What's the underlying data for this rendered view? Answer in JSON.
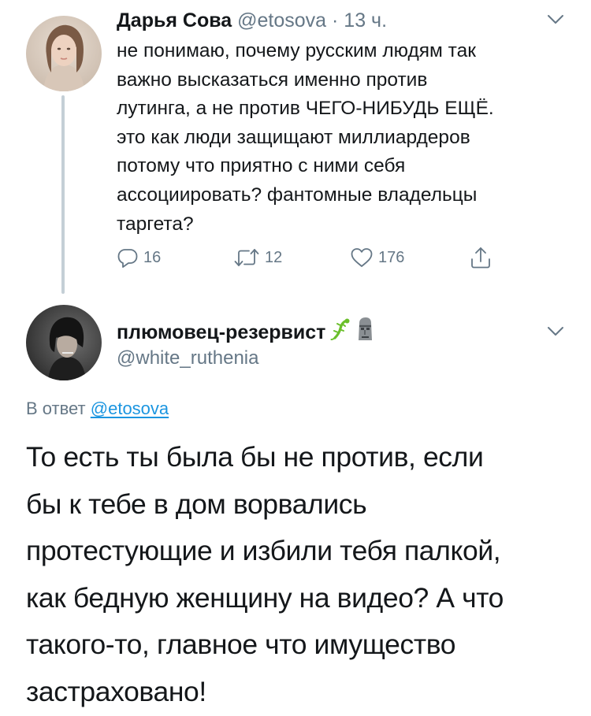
{
  "tweet1": {
    "author_name": "Дарья Сова",
    "handle": "@etosova",
    "separator": "·",
    "time": "13 ч.",
    "text_lines": [
      "не понимаю, почему русским людям так",
      "важно высказаться именно против",
      "лутинга, а не против ЧЕГО-НИБУДЬ ЕЩЁ.",
      "это как люди защищают миллиардеров",
      "потому что приятно с ними себя",
      "ассоциировать? фантомные владельцы",
      "таргета?"
    ],
    "reply_count": "16",
    "retweet_count": "12",
    "like_count": "176"
  },
  "tweet2": {
    "author_name": "плюмовец-резервист",
    "handle": "@white_ruthenia",
    "reply_prefix": "В ответ",
    "reply_mention": "@etosova",
    "text_lines": [
      "То есть ты была бы не против, если",
      "бы к тебе в дом ворвались",
      "протестующие и избили тебя палкой,",
      "как бедную женщину на видео? А что",
      "такого-то, главное что имущество",
      "застраховано!"
    ]
  },
  "icons": {
    "reply": "reply-icon",
    "retweet": "retweet-icon",
    "like": "heart-icon",
    "share": "share-icon",
    "menu": "chevron-down-icon",
    "name_emoji_1": "lizard-emoji",
    "name_emoji_2": "moai-emoji"
  },
  "colors": {
    "text": "#14171a",
    "secondary": "#657786",
    "link": "#1b95e0",
    "thread_line": "#c4cfd6"
  }
}
